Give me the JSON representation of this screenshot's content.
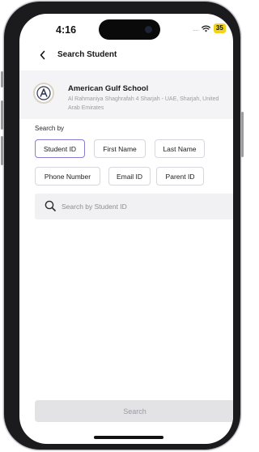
{
  "status_bar": {
    "time": "4:16",
    "signal": "....",
    "battery": "35"
  },
  "header": {
    "title": "Search Student",
    "back_icon": "chevron-left-icon"
  },
  "school": {
    "logo_letter": "A",
    "name": "American Gulf School",
    "address": "Al Rahmaniya Shaghrafah 4 Sharjah - UAE, Sharjah, United Arab Emirates"
  },
  "search_by": {
    "label": "Search by",
    "options": [
      "Student ID",
      "First Name",
      "Last Name",
      "Phone Number",
      "Email ID",
      "Parent ID"
    ],
    "selected": "Student ID"
  },
  "search": {
    "placeholder": "Search by Student ID",
    "icon": "search-icon"
  },
  "actions": {
    "search_label": "Search"
  },
  "colors": {
    "accent": "#8a7bd1",
    "battery": "#f2d21a",
    "school_card_bg": "#f4f4f6",
    "disabled_button_bg": "#e3e3e6"
  }
}
